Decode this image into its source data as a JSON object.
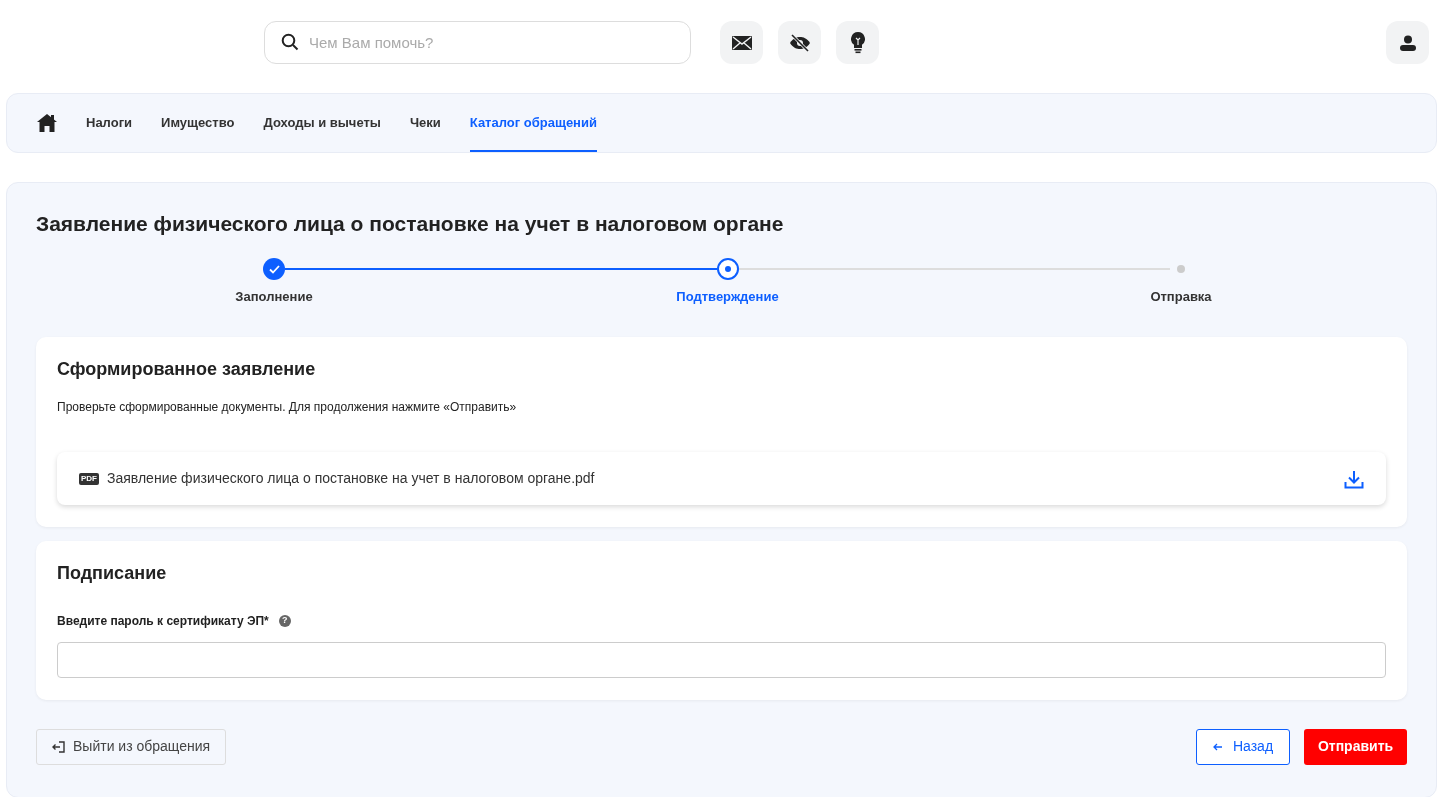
{
  "search": {
    "placeholder": "Чем Вам помочь?"
  },
  "nav": [
    {
      "kind": "home",
      "selected": false
    },
    {
      "kind": "link",
      "label": "Налоги",
      "selected": false
    },
    {
      "kind": "link",
      "label": "Имущество",
      "selected": false
    },
    {
      "kind": "link",
      "label": "Доходы и вычеты",
      "selected": false
    },
    {
      "kind": "link",
      "label": "Чеки",
      "selected": false
    },
    {
      "kind": "link",
      "label": "Каталог обращений",
      "selected": true
    }
  ],
  "page_title": "Заявление физического лица о постановке на учет в налоговом органе",
  "steps": [
    {
      "label": "Заполнение",
      "kind": "done"
    },
    {
      "label": "Подтверждение",
      "kind": "current"
    },
    {
      "label": "Отправка",
      "kind": "pending"
    }
  ],
  "document_card": {
    "title": "Сформированное заявление",
    "hint": "Проверьте сформированные документы. Для продолжения нажмите «Отправить»",
    "file": {
      "badge": "PDF",
      "name": "Заявление физического лица о постановке на учет в налоговом органе.pdf"
    }
  },
  "signing_card": {
    "title": "Подписание",
    "field_label": "Введите пароль к сертификату ЭП*",
    "help": "?"
  },
  "buttons": {
    "exit": "Выйти из обращения",
    "back": "Назад",
    "submit": "Отправить"
  }
}
